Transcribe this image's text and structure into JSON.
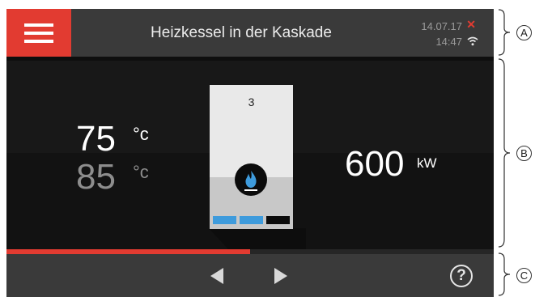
{
  "header": {
    "title": "Heizkessel in der Kaskade",
    "date": "14.07.17",
    "time": "14:47",
    "status_error_icon": "x-icon",
    "wifi_icon": "wifi-icon"
  },
  "main": {
    "flow_temp": "75",
    "flow_temp_unit": "°c",
    "return_temp": "85",
    "return_temp_unit": "°c",
    "boiler_number": "3",
    "boiler_icon": "gas-flame-icon",
    "power_value": "600",
    "power_unit": "kW",
    "segments": [
      "active",
      "active",
      "inactive"
    ]
  },
  "progress": {
    "fraction": 0.5
  },
  "footer": {
    "prev_icon": "triangle-left-icon",
    "next_icon": "triangle-right-icon",
    "help_icon": "question-icon",
    "help_glyph": "?"
  },
  "callouts": [
    "A",
    "B",
    "C"
  ],
  "colors": {
    "accent": "#e23b31",
    "segment_active": "#3e9bdc",
    "segment_inactive": "#0b0b0b",
    "flame": "#3e9bdc"
  }
}
